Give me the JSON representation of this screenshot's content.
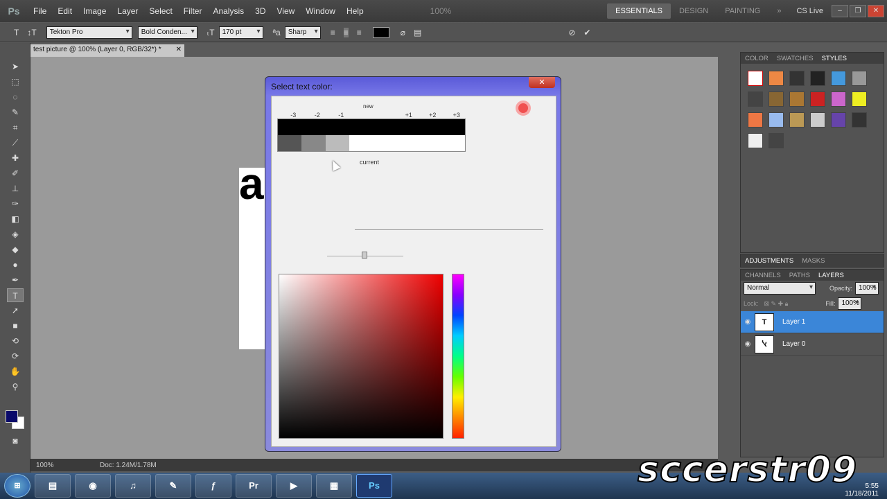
{
  "menubar": {
    "logo": "Ps",
    "items": [
      "File",
      "Edit",
      "Image",
      "Layer",
      "Select",
      "Filter",
      "Analysis",
      "3D",
      "View",
      "Window",
      "Help"
    ],
    "zoom": "100%",
    "workspaces": [
      "ESSENTIALS",
      "DESIGN",
      "PAINTING"
    ],
    "active_workspace": "ESSENTIALS",
    "cslive": "CS Live"
  },
  "options": {
    "font_family": "Tekton Pro",
    "font_style": "Bold Conden...",
    "font_size": "170 pt",
    "aa_mode": "Sharp",
    "text_color": "#000000"
  },
  "document": {
    "tab_title": "test picture @ 100% (Layer 0, RGB/32*) *",
    "canvas_text": "a",
    "status_zoom": "100%",
    "status_doc": "Doc: 1.24M/1.78M"
  },
  "dialog": {
    "title": "Select text color:",
    "close": "✕",
    "variation_labels": [
      "-3",
      "-2",
      "-1",
      "+1",
      "+2",
      "+3"
    ],
    "label_new": "new",
    "label_current": "current",
    "new_color": "#000000",
    "current_color": "#ffffff"
  },
  "panel_top": {
    "tabs": [
      "COLOR",
      "SWATCHES",
      "STYLES"
    ],
    "active": "STYLES"
  },
  "panel_adj": {
    "tabs": [
      "ADJUSTMENTS",
      "MASKS"
    ]
  },
  "layers_panel": {
    "tabs": [
      "CHANNELS",
      "PATHS",
      "LAYERS"
    ],
    "active": "LAYERS",
    "blend_mode": "Normal",
    "opacity_label": "Opacity:",
    "opacity": "100%",
    "lock_label": "Lock:",
    "fill_label": "Fill:",
    "fill": "100%",
    "layers": [
      {
        "name": "Layer 1",
        "thumb": "T",
        "selected": true
      },
      {
        "name": "Layer 0",
        "thumb": "ﭏ",
        "selected": false
      }
    ]
  },
  "taskbar": {
    "apps": [
      "Explorer",
      "Chrome",
      "iTunes",
      "Notes",
      "Flash",
      "Premiere",
      "Media",
      "Folder",
      "Ps"
    ],
    "clock_time": "5:55",
    "clock_date": "11/18/2011"
  },
  "watermark": "sccerstr09"
}
